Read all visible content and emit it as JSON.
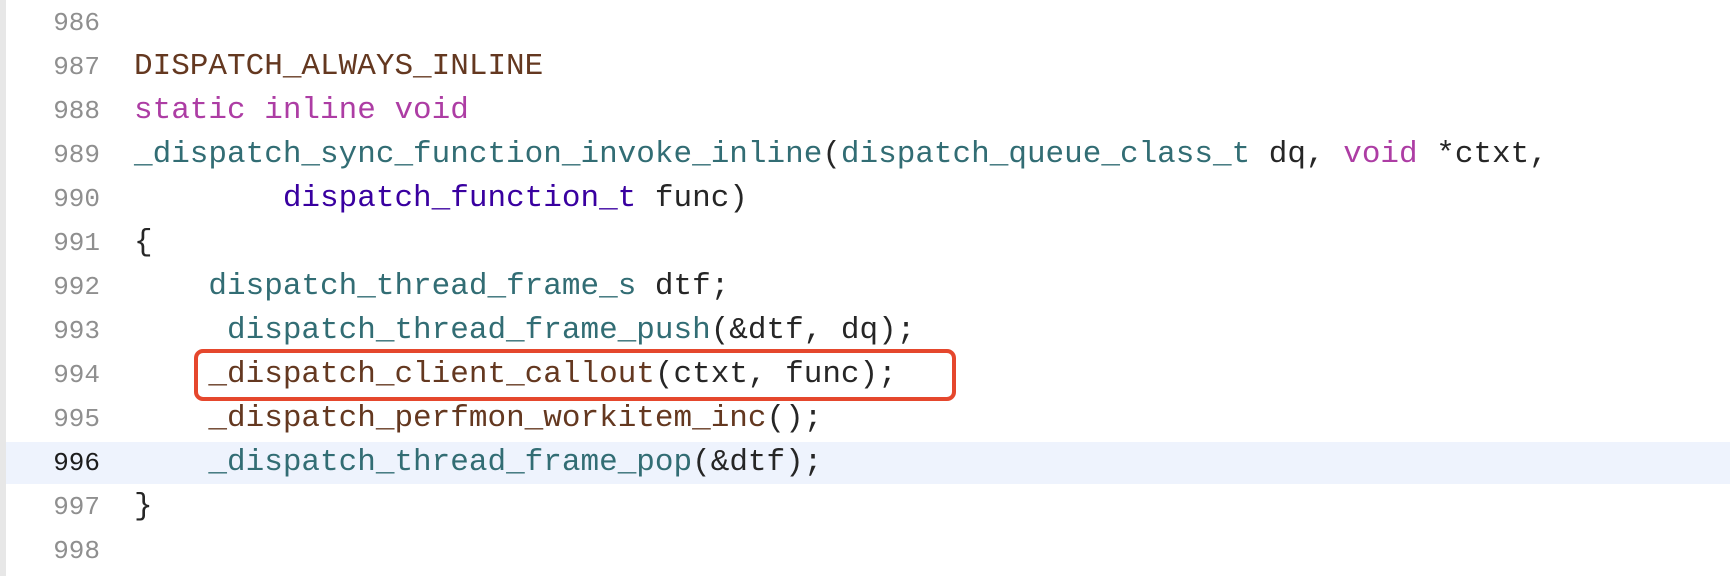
{
  "editor": {
    "current_line": "996",
    "lines": [
      {
        "num": "986",
        "tokens": []
      },
      {
        "num": "987",
        "tokens": [
          {
            "text": "DISPATCH_ALWAYS_INLINE",
            "kind": "macro"
          }
        ]
      },
      {
        "num": "988",
        "tokens": [
          {
            "text": "static inline void",
            "kind": "kw"
          }
        ]
      },
      {
        "num": "989",
        "tokens": [
          {
            "text": "_dispatch_sync_function_invoke_inline",
            "kind": "fn"
          },
          {
            "text": "(",
            "kind": "plain"
          },
          {
            "text": "dispatch_queue_class_t",
            "kind": "type"
          },
          {
            "text": " dq, ",
            "kind": "plain"
          },
          {
            "text": "void",
            "kind": "kw"
          },
          {
            "text": " *ctxt,",
            "kind": "plain"
          }
        ]
      },
      {
        "num": "990",
        "tokens": [
          {
            "text": "        ",
            "kind": "plain"
          },
          {
            "text": "dispatch_function_t",
            "kind": "type2"
          },
          {
            "text": " func)",
            "kind": "plain"
          }
        ]
      },
      {
        "num": "991",
        "tokens": [
          {
            "text": "{",
            "kind": "plain"
          }
        ]
      },
      {
        "num": "992",
        "tokens": [
          {
            "text": "    ",
            "kind": "plain"
          },
          {
            "text": "dispatch_thread_frame_s",
            "kind": "type"
          },
          {
            "text": " dtf;",
            "kind": "plain"
          }
        ]
      },
      {
        "num": "993",
        "tokens": [
          {
            "text": "     ",
            "kind": "plain"
          },
          {
            "text": "dispatch_thread_frame_push",
            "kind": "call2"
          },
          {
            "text": "(&dtf, dq);",
            "kind": "plain"
          }
        ]
      },
      {
        "num": "994",
        "tokens": [
          {
            "text": "    ",
            "kind": "plain"
          },
          {
            "text": "_dispatch_client_callout",
            "kind": "call"
          },
          {
            "text": "(ctxt, func);",
            "kind": "plain"
          }
        ]
      },
      {
        "num": "995",
        "tokens": [
          {
            "text": "    ",
            "kind": "plain"
          },
          {
            "text": "_dispatch_perfmon_workitem_inc",
            "kind": "call"
          },
          {
            "text": "();",
            "kind": "plain"
          }
        ]
      },
      {
        "num": "996",
        "tokens": [
          {
            "text": "    ",
            "kind": "plain"
          },
          {
            "text": "_dispatch_thread_frame_pop",
            "kind": "call2"
          },
          {
            "text": "(&dtf);",
            "kind": "plain"
          }
        ]
      },
      {
        "num": "997",
        "tokens": [
          {
            "text": "}",
            "kind": "plain"
          }
        ]
      },
      {
        "num": "998",
        "tokens": []
      }
    ]
  },
  "colors": {
    "highlight_box": "#e5472d",
    "current_line_band": "#eef3fd",
    "keyword": "#ad3da4",
    "macro": "#643820",
    "function": "#326d74",
    "type_param": "#3900a0"
  }
}
